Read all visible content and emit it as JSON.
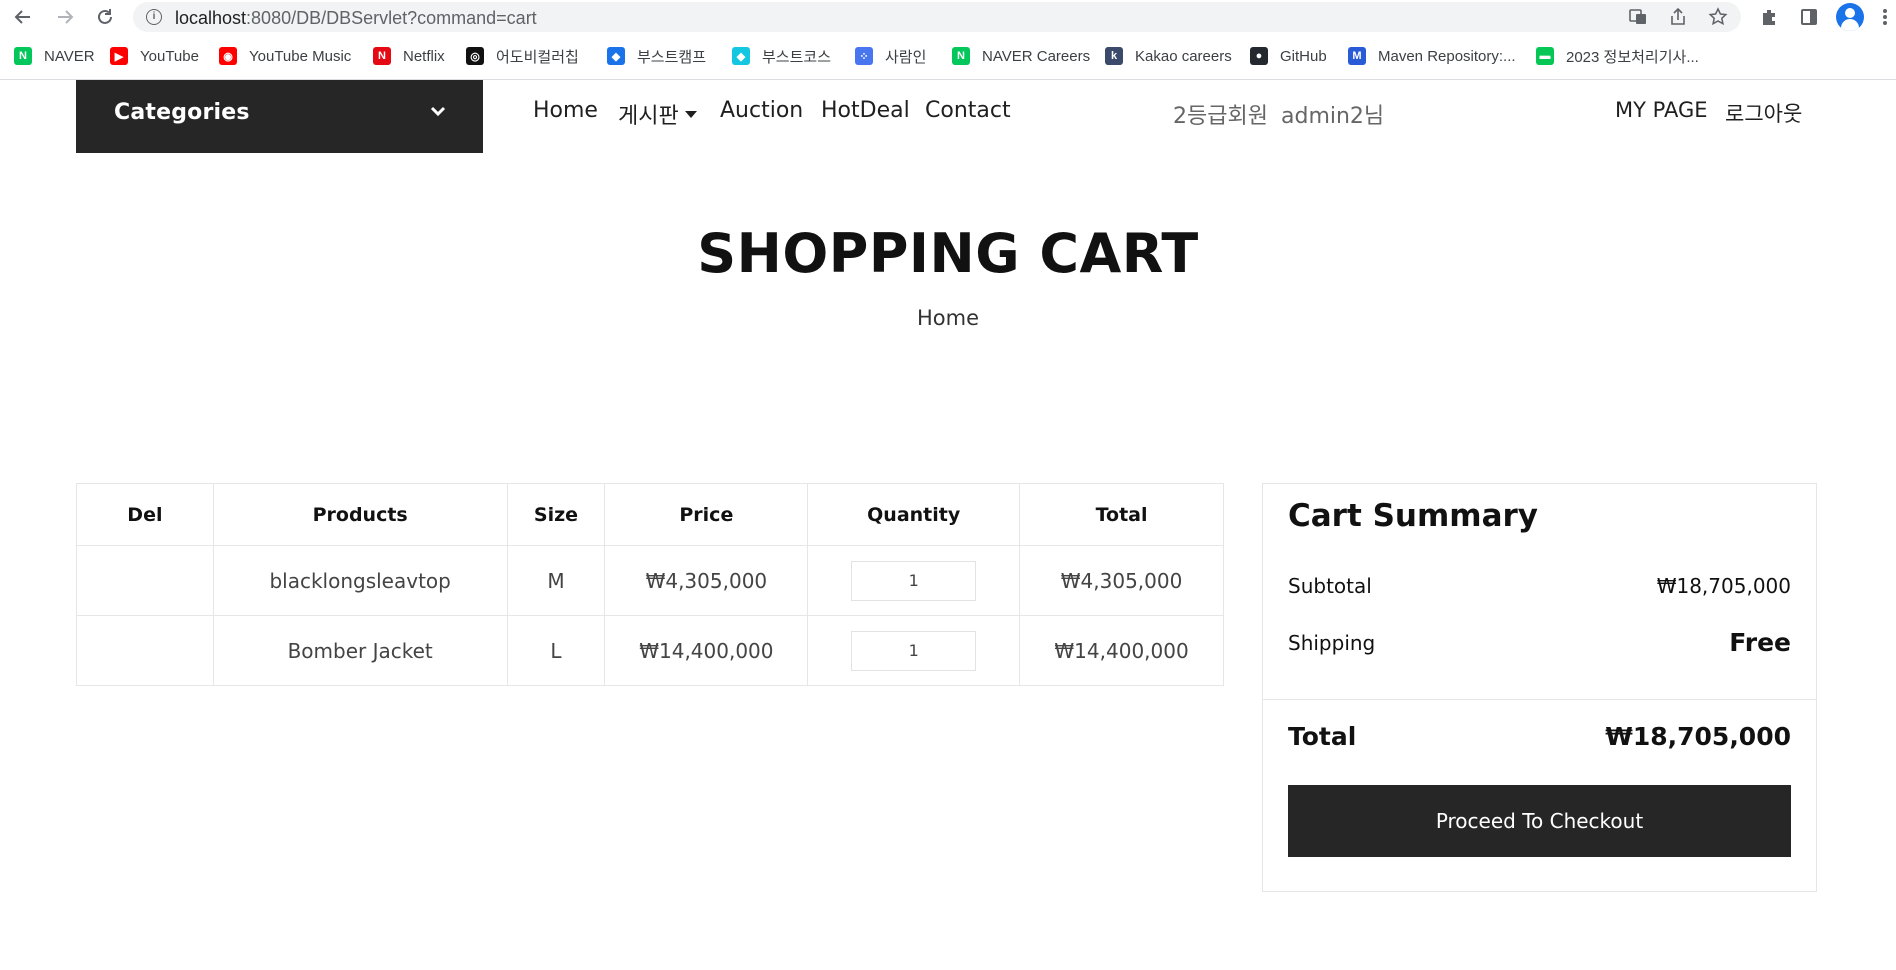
{
  "browser": {
    "url_host": "localhost",
    "url_rest": ":8080/DB/DBServlet?command=cart",
    "bookmarks": [
      {
        "label": "NAVER",
        "icon": "naver-icon",
        "color": "#03c75a",
        "glyph": "N"
      },
      {
        "label": "YouTube",
        "icon": "youtube-icon",
        "color": "#ff0000",
        "glyph": "▶"
      },
      {
        "label": "YouTube Music",
        "icon": "youtube-music-icon",
        "color": "#ff0000",
        "glyph": "◉"
      },
      {
        "label": "Netflix",
        "icon": "netflix-icon",
        "color": "#e50914",
        "glyph": "N"
      },
      {
        "label": "어도비컬러칩",
        "icon": "adobe-color-icon",
        "color": "#111111",
        "glyph": "◎"
      },
      {
        "label": "부스트캠프",
        "icon": "boostcamp-icon",
        "color": "#1a73e8",
        "glyph": "◆"
      },
      {
        "label": "부스트코스",
        "icon": "boostcourse-icon",
        "color": "#14c7e0",
        "glyph": "◆"
      },
      {
        "label": "사람인",
        "icon": "saramin-icon",
        "color": "#4876ef",
        "glyph": "⁘"
      },
      {
        "label": "NAVER Careers",
        "icon": "naver-careers-icon",
        "color": "#03c75a",
        "glyph": "N"
      },
      {
        "label": "Kakao careers",
        "icon": "kakao-careers-icon",
        "color": "#3b4a6b",
        "glyph": "k"
      },
      {
        "label": "GitHub",
        "icon": "github-icon",
        "color": "#24292f",
        "glyph": "●"
      },
      {
        "label": "Maven Repository:...",
        "icon": "maven-icon",
        "color": "#2a5bd7",
        "glyph": "M"
      },
      {
        "label": "2023 정보처리기사...",
        "icon": "line-icon",
        "color": "#06c755",
        "glyph": "▬"
      }
    ]
  },
  "header": {
    "categories_label": "Categories",
    "nav": [
      "Home",
      "게시판",
      "Auction",
      "HotDeal",
      "Contact"
    ],
    "user_grade": "2등급회원",
    "user_name": "admin2님",
    "mypage": "MY PAGE",
    "logout": "로그아웃"
  },
  "banner": {
    "title": "SHOPPING CART",
    "breadcrumb": "Home"
  },
  "cart": {
    "columns": [
      "Del",
      "Products",
      "Size",
      "Price",
      "Quantity",
      "Total"
    ],
    "rows": [
      {
        "del": "",
        "product": "blacklongsleavtop",
        "size": "M",
        "price": "₩4,305,000",
        "quantity": "1",
        "total": "₩4,305,000"
      },
      {
        "del": "",
        "product": "Bomber Jacket",
        "size": "L",
        "price": "₩14,400,000",
        "quantity": "1",
        "total": "₩14,400,000"
      }
    ]
  },
  "summary": {
    "title": "Cart Summary",
    "subtotal_label": "Subtotal",
    "subtotal": "₩18,705,000",
    "shipping_label": "Shipping",
    "shipping": "Free",
    "total_label": "Total",
    "total": "₩18,705,000",
    "checkout_label": "Proceed To Checkout"
  },
  "colors": {
    "dark": "#262626",
    "border": "#e6e6e6",
    "text_muted": "#666666"
  }
}
